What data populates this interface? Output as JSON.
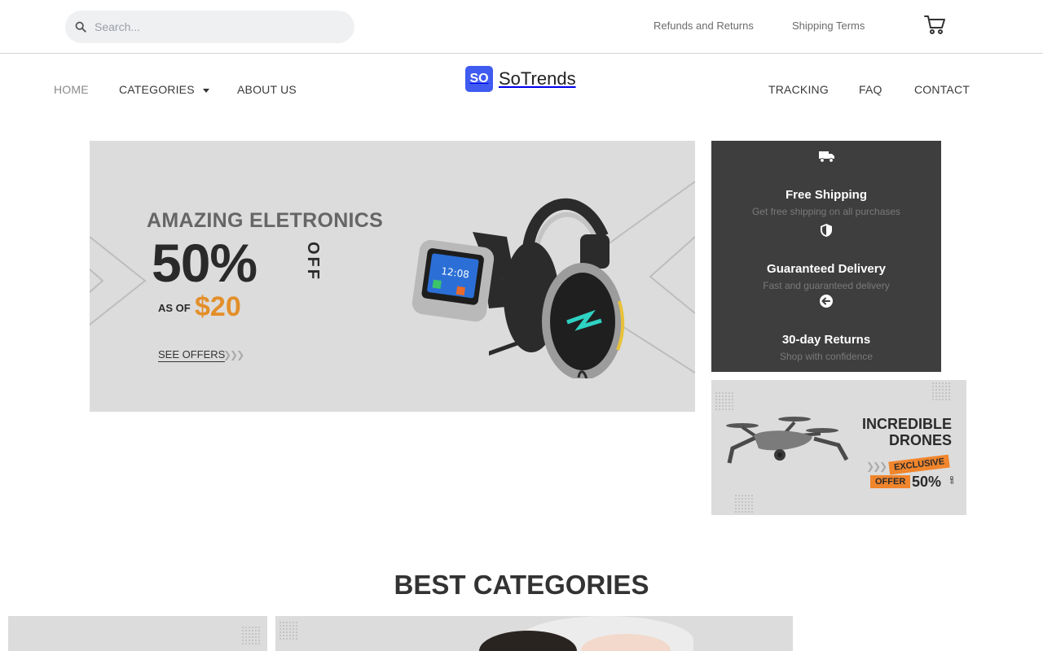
{
  "topbar": {
    "search_placeholder": "Search...",
    "links": [
      "Refunds and Returns",
      "Shipping Terms"
    ]
  },
  "nav": {
    "left": [
      "HOME",
      "CATEGORIES",
      "ABOUT US"
    ],
    "right": [
      "TRACKING",
      "FAQ",
      "CONTACT"
    ],
    "logo_badge": "SO",
    "logo_text": "SoTrends"
  },
  "hero": {
    "title": "AMAZING ELETRONICS",
    "percent": "50%",
    "off": "OFF",
    "as_of": "AS OF",
    "price": "$20",
    "cta": "SEE OFFERS"
  },
  "features": [
    {
      "icon": "truck-icon",
      "title": "Free Shipping",
      "desc": "Get free shipping on all purchases"
    },
    {
      "icon": "shield-icon",
      "title": "Guaranteed Delivery",
      "desc": "Fast and guaranteed delivery"
    },
    {
      "icon": "arrow-left-circle-icon",
      "title": "30-day Returns",
      "desc": "Shop with confidence"
    }
  ],
  "drone": {
    "title_line1": "INCREDIBLE",
    "title_line2": "DRONES",
    "exclusive": "EXCLUSIVE",
    "offer": "OFFER",
    "percent": "50%",
    "off": "OFF"
  },
  "section": {
    "title": "BEST CATEGORIES"
  },
  "colors": {
    "accent": "#3f5bf0",
    "price": "#e38f2a",
    "offer_tag": "#f0852c",
    "dark_panel": "#3e3e3e"
  }
}
